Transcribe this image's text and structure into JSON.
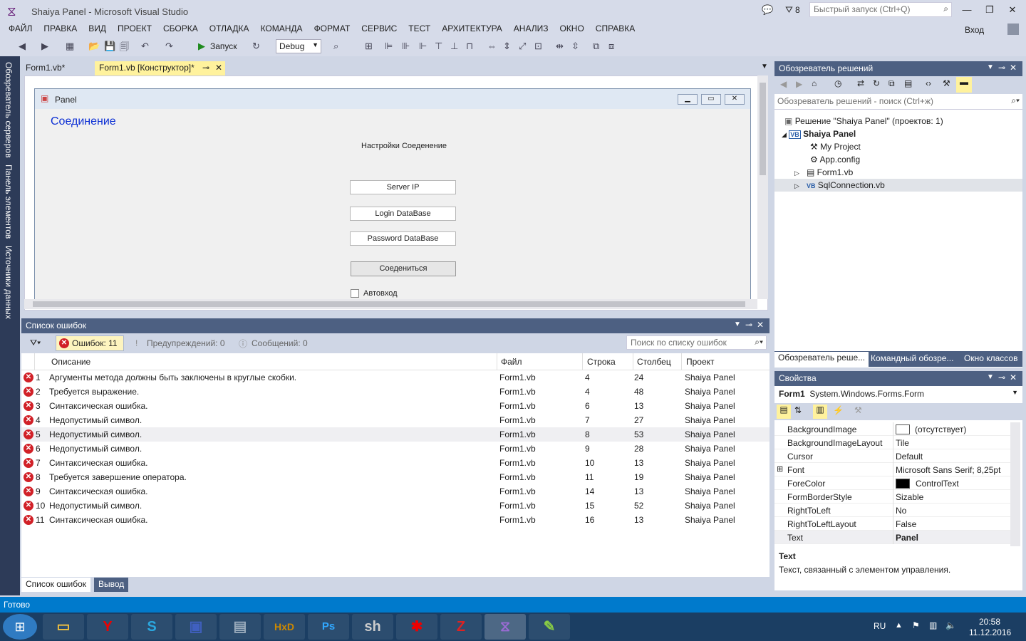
{
  "window": {
    "title": "Shaiya Panel - Microsoft Visual Studio",
    "notifications": "8",
    "quick_launch_placeholder": "Быстрый запуск (Ctrl+Q)",
    "sign_in": "Вход"
  },
  "menu": [
    "ФАЙЛ",
    "ПРАВКА",
    "ВИД",
    "ПРОЕКТ",
    "СБОРКА",
    "ОТЛАДКА",
    "КОМАНДА",
    "ФОРМАТ",
    "СЕРВИС",
    "ТЕСТ",
    "АРХИТЕКТУРА",
    "АНАЛИЗ",
    "ОКНО",
    "СПРАВКА"
  ],
  "toolbar": {
    "start_label": "Запуск",
    "config": "Debug"
  },
  "left_tabs": [
    "Обозреватель серверов",
    "Панель элементов",
    "Источники данных"
  ],
  "doc_tabs": [
    "Form1.vb*",
    "Form1.vb [Конструктор]*"
  ],
  "form": {
    "caption": "Panel",
    "heading": "Соединение",
    "subheading": "Настройки Соеденение",
    "fields": [
      "Server IP",
      "Login DataBase",
      "Password DataBase"
    ],
    "button": "Соедениться",
    "checkbox": "Автовход"
  },
  "error_list": {
    "title": "Список ошибок",
    "errors_btn": "Ошибок: 11",
    "warnings": "Предупреждений: 0",
    "messages": "Сообщений: 0",
    "search_placeholder": "Поиск по списку ошибок",
    "columns": [
      "Описание",
      "Файл",
      "Строка",
      "Столбец",
      "Проект"
    ],
    "rows": [
      {
        "n": "1",
        "desc": "Аргументы метода должны быть заключены в круглые скобки.",
        "file": "Form1.vb",
        "line": "4",
        "col": "24",
        "project": "Shaiya Panel"
      },
      {
        "n": "2",
        "desc": "Требуется выражение.",
        "file": "Form1.vb",
        "line": "4",
        "col": "48",
        "project": "Shaiya Panel"
      },
      {
        "n": "3",
        "desc": "Синтаксическая ошибка.",
        "file": "Form1.vb",
        "line": "6",
        "col": "13",
        "project": "Shaiya Panel"
      },
      {
        "n": "4",
        "desc": "Недопустимый символ.",
        "file": "Form1.vb",
        "line": "7",
        "col": "27",
        "project": "Shaiya Panel"
      },
      {
        "n": "5",
        "desc": "Недопустимый символ.",
        "file": "Form1.vb",
        "line": "8",
        "col": "53",
        "project": "Shaiya Panel"
      },
      {
        "n": "6",
        "desc": "Недопустимый символ.",
        "file": "Form1.vb",
        "line": "9",
        "col": "28",
        "project": "Shaiya Panel"
      },
      {
        "n": "7",
        "desc": "Синтаксическая ошибка.",
        "file": "Form1.vb",
        "line": "10",
        "col": "13",
        "project": "Shaiya Panel"
      },
      {
        "n": "8",
        "desc": "Требуется завершение оператора.",
        "file": "Form1.vb",
        "line": "11",
        "col": "19",
        "project": "Shaiya Panel"
      },
      {
        "n": "9",
        "desc": "Синтаксическая ошибка.",
        "file": "Form1.vb",
        "line": "14",
        "col": "13",
        "project": "Shaiya Panel"
      },
      {
        "n": "10",
        "desc": "Недопустимый символ.",
        "file": "Form1.vb",
        "line": "15",
        "col": "52",
        "project": "Shaiya Panel"
      },
      {
        "n": "11",
        "desc": "Синтаксическая ошибка.",
        "file": "Form1.vb",
        "line": "16",
        "col": "13",
        "project": "Shaiya Panel"
      }
    ],
    "bottom_tabs": [
      "Список ошибок",
      "Вывод"
    ]
  },
  "solution": {
    "title": "Обозреватель решений",
    "search_placeholder": "Обозреватель решений - поиск (Ctrl+ж)",
    "items": [
      "Решение \"Shaiya Panel\"  (проектов: 1)",
      "Shaiya Panel",
      "My Project",
      "App.config",
      "Form1.vb",
      "SqlConnection.vb"
    ],
    "bottom_tabs": [
      "Обозреватель реше...",
      "Командный обозре...",
      "Окно классов"
    ]
  },
  "properties": {
    "title": "Свойства",
    "object_name": "Form1",
    "object_type": "System.Windows.Forms.Form",
    "rows": [
      {
        "name": "BackgroundImage",
        "value": "(отсутствует)"
      },
      {
        "name": "BackgroundImageLayout",
        "value": "Tile"
      },
      {
        "name": "Cursor",
        "value": "Default"
      },
      {
        "name": "Font",
        "value": "Microsoft Sans Serif; 8,25pt"
      },
      {
        "name": "ForeColor",
        "value": "ControlText"
      },
      {
        "name": "FormBorderStyle",
        "value": "Sizable"
      },
      {
        "name": "RightToLeft",
        "value": "No"
      },
      {
        "name": "RightToLeftLayout",
        "value": "False"
      },
      {
        "name": "Text",
        "value": "Panel"
      }
    ],
    "desc_name": "Text",
    "desc_text": "Текст, связанный с элементом управления."
  },
  "status": "Готово",
  "taskbar": {
    "lang": "RU",
    "time": "20:58",
    "date": "11.12.2016"
  },
  "colors": {
    "accent": "#007acc",
    "panel_title": "#4d6082",
    "error": "#d12027"
  }
}
